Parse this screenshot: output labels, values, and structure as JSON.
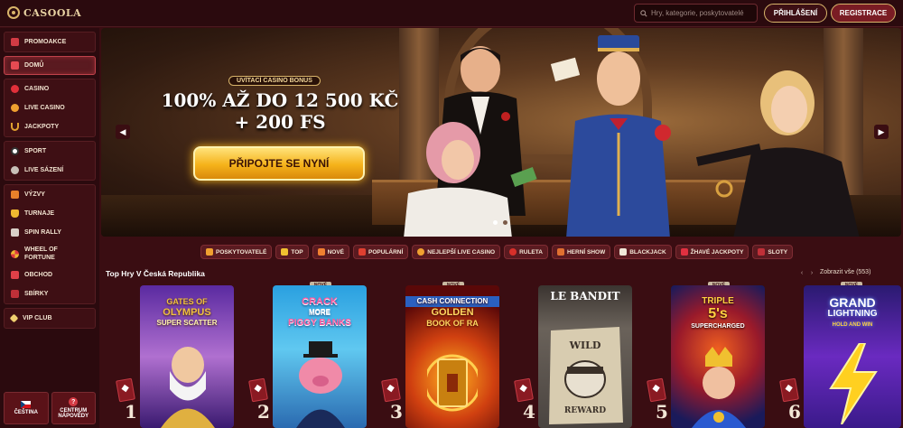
{
  "header": {
    "logo_text": "CASOOLA",
    "search_placeholder": "Hry, kategorie, poskytovatelé",
    "login_label": "PŘIHLÁŠENÍ",
    "register_label": "REGISTRACE"
  },
  "sidebar": {
    "groups": [
      [
        {
          "label": "PROMOAKCE",
          "icon": "gift-icon"
        }
      ],
      [
        {
          "label": "DOMŮ",
          "icon": "home-icon",
          "active": true
        }
      ],
      [
        {
          "label": "CASINO",
          "icon": "cherries-icon"
        },
        {
          "label": "LIVE CASINO",
          "icon": "chip-icon"
        },
        {
          "label": "JACKPOTY",
          "icon": "horseshoe-icon"
        }
      ],
      [
        {
          "label": "SPORT",
          "icon": "football-icon"
        },
        {
          "label": "LIVE SÁZENÍ",
          "icon": "live-icon"
        }
      ],
      [
        {
          "label": "VÝZVY",
          "icon": "target-icon"
        },
        {
          "label": "TURNAJE",
          "icon": "trophy-icon"
        },
        {
          "label": "SPIN RALLY",
          "icon": "rally-icon"
        },
        {
          "label": "WHEEL OF FORTUNE",
          "icon": "wheel-icon"
        },
        {
          "label": "OBCHOD",
          "icon": "shop-icon"
        },
        {
          "label": "SBÍRKY",
          "icon": "collection-icon"
        }
      ],
      [
        {
          "label": "VIP CLUB",
          "icon": "diamond-icon"
        }
      ]
    ],
    "footer": {
      "language_label": "ČEŠTINA",
      "help_label_1": "CENTRUM",
      "help_label_2": "NÁPOVĚDY"
    }
  },
  "banner": {
    "subtitle": "UVÍTACÍ CASINO BONUS",
    "title_line1": "100% AŽ DO 12 500 KČ",
    "title_line2": "+ 200 FS",
    "cta_label": "PŘIPOJTE SE NYNÍ",
    "slide_count": 2,
    "active_slide": 1
  },
  "categories": [
    {
      "label": "POSKYTOVATELÉ",
      "icon": "provider-icon"
    },
    {
      "label": "TOP",
      "icon": "crown-icon"
    },
    {
      "label": "NOVÉ",
      "icon": "star-icon"
    },
    {
      "label": "POPULÁRNÍ",
      "icon": "fire-icon"
    },
    {
      "label": "NEJLEPŠÍ LIVE CASINO",
      "icon": "chip-icon"
    },
    {
      "label": "RULETA",
      "icon": "roulette-icon"
    },
    {
      "label": "HERNÍ SHOW",
      "icon": "show-icon"
    },
    {
      "label": "BLACKJACK",
      "icon": "cards-icon"
    },
    {
      "label": "ŽHAVÉ JACKPOTY",
      "icon": "jackpot-icon"
    },
    {
      "label": "SLOTY",
      "icon": "slot-icon"
    }
  ],
  "games_section": {
    "title": "Top Hry V Česká Republika",
    "view_all": "Zobrazit vše (553)",
    "new_badge": "NOVÉ",
    "games": [
      {
        "rank": "1",
        "title": "Gates of Olympus Super Scatter",
        "new": false,
        "bg": "#6a3aa8"
      },
      {
        "rank": "2",
        "title": "Crack More Piggy Banks",
        "new": true,
        "bg": "#2a9ad0"
      },
      {
        "rank": "3",
        "title": "Cash Connection Golden Book of Ra",
        "new": true,
        "bg": "#7a0c10"
      },
      {
        "rank": "4",
        "title": "Le Bandit",
        "new": false,
        "bg": "#8a8478"
      },
      {
        "rank": "5",
        "title": "Triple 5's Supercharged",
        "new": true,
        "bg": "#1a2a7a"
      },
      {
        "rank": "6",
        "title": "Grand Lightning Hold and Win",
        "new": true,
        "bg": "#3a1a8a"
      }
    ],
    "card_texts": {
      "g1": [
        "GATES OF",
        "OLYMPUS",
        "SUPER SCATTER"
      ],
      "g2": [
        "CRACK",
        "MORE",
        "PIGGY BANKS"
      ],
      "g3": [
        "CASH CONNECTION",
        "GOLDEN",
        "BOOK OF RA"
      ],
      "g4": [
        "LE BANDIT",
        "WILD",
        "REWARD"
      ],
      "g5": [
        "TRIPLE",
        "5's",
        "SUPERCHARGED"
      ],
      "g6": [
        "GRAND",
        "LIGHTNING",
        "HOLD AND WIN"
      ]
    }
  }
}
